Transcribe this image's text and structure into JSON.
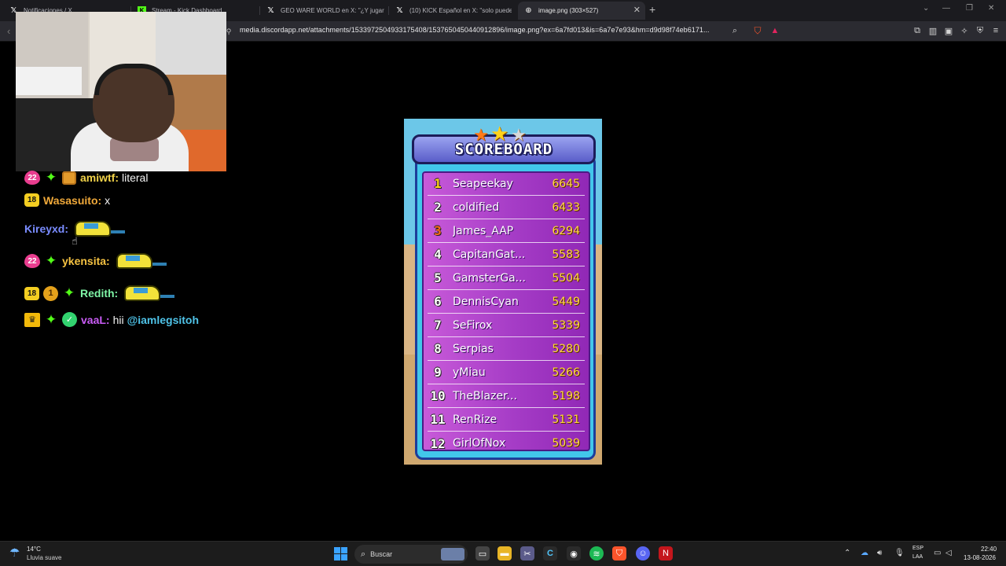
{
  "browser": {
    "tabs": [
      {
        "title": "Notificaciones / X",
        "icon": "x-logo-icon"
      },
      {
        "title": "Stream - Kick Dashboard",
        "icon": "kick-icon"
      },
      {
        "title": "GEO WARE WORLD en X: \"¿Y jugar M",
        "icon": "x-logo-icon"
      },
      {
        "title": "(10) KICK Español en X: \"solo puedes",
        "icon": "x-logo-icon"
      },
      {
        "title": "image.png (303×527)",
        "icon": "globe-icon",
        "active": true
      }
    ],
    "new_tab": "+",
    "url": "media.discordapp.net/attachments/1533972504933175408/1537650450440912896/image.png?ex=6a7fd013&is=6a7e7e93&hm=d9d98f74eb6171..."
  },
  "chat": [
    {
      "badges": [
        "22",
        "spark",
        "box"
      ],
      "user": "amiwtf:",
      "user_color": "#f2d34a",
      "message": "literal"
    },
    {
      "badges": [
        "18"
      ],
      "user": "Wasasuito:",
      "user_color": "#f0a93a",
      "message": "x"
    },
    {
      "badges": [],
      "user": "Kireyxd:",
      "user_color": "#7a8cff",
      "emote": "car-emote"
    },
    {
      "badges": [
        "22",
        "spark"
      ],
      "user": "ykensita:",
      "user_color": "#f5c242",
      "emote": "car-emote"
    },
    {
      "badges": [
        "18",
        "1",
        "spark"
      ],
      "user": "Redith:",
      "user_color": "#7ff5a6",
      "emote": "car-emote"
    },
    {
      "badges": [
        "crown",
        "spark",
        "verified"
      ],
      "user": "vaaL:",
      "user_color": "#c95cf5",
      "message": "hii",
      "mention": "@iamlegsitoh"
    }
  ],
  "scoreboard": {
    "title": "SCOREBOARD",
    "rows": [
      {
        "rank": "1",
        "name": "Seapeekay",
        "score": "6645",
        "rank_color": "#ffd21a"
      },
      {
        "rank": "2",
        "name": "coldified",
        "score": "6433",
        "rank_color": "#ffffff"
      },
      {
        "rank": "3",
        "name": "James_AAP",
        "score": "6294",
        "rank_color": "#ff6a1a"
      },
      {
        "rank": "4",
        "name": "CapitanGat...",
        "score": "5583",
        "rank_color": "#ffffff"
      },
      {
        "rank": "5",
        "name": "GamsterGa...",
        "score": "5504",
        "rank_color": "#ffffff"
      },
      {
        "rank": "6",
        "name": "DennisCyan",
        "score": "5449",
        "rank_color": "#ffffff"
      },
      {
        "rank": "7",
        "name": "SeFirox",
        "score": "5339",
        "rank_color": "#ffffff"
      },
      {
        "rank": "8",
        "name": "Serpias",
        "score": "5280",
        "rank_color": "#ffffff"
      },
      {
        "rank": "9",
        "name": "yMiau",
        "score": "5266",
        "rank_color": "#ffffff"
      },
      {
        "rank": "10",
        "name": "TheBlazer...",
        "score": "5198",
        "rank_color": "#ffffff"
      },
      {
        "rank": "11",
        "name": "RenRize",
        "score": "5131",
        "rank_color": "#ffffff"
      },
      {
        "rank": "12",
        "name": "GirlOfNox",
        "score": "5039",
        "rank_color": "#ffffff"
      }
    ]
  },
  "taskbar": {
    "weather_temp": "14°C",
    "weather_desc": "Lluvia suave",
    "search_placeholder": "Buscar",
    "lang_top": "ESP",
    "lang_bottom": "LAA",
    "time": "22:40",
    "date": "13-08-2026"
  }
}
